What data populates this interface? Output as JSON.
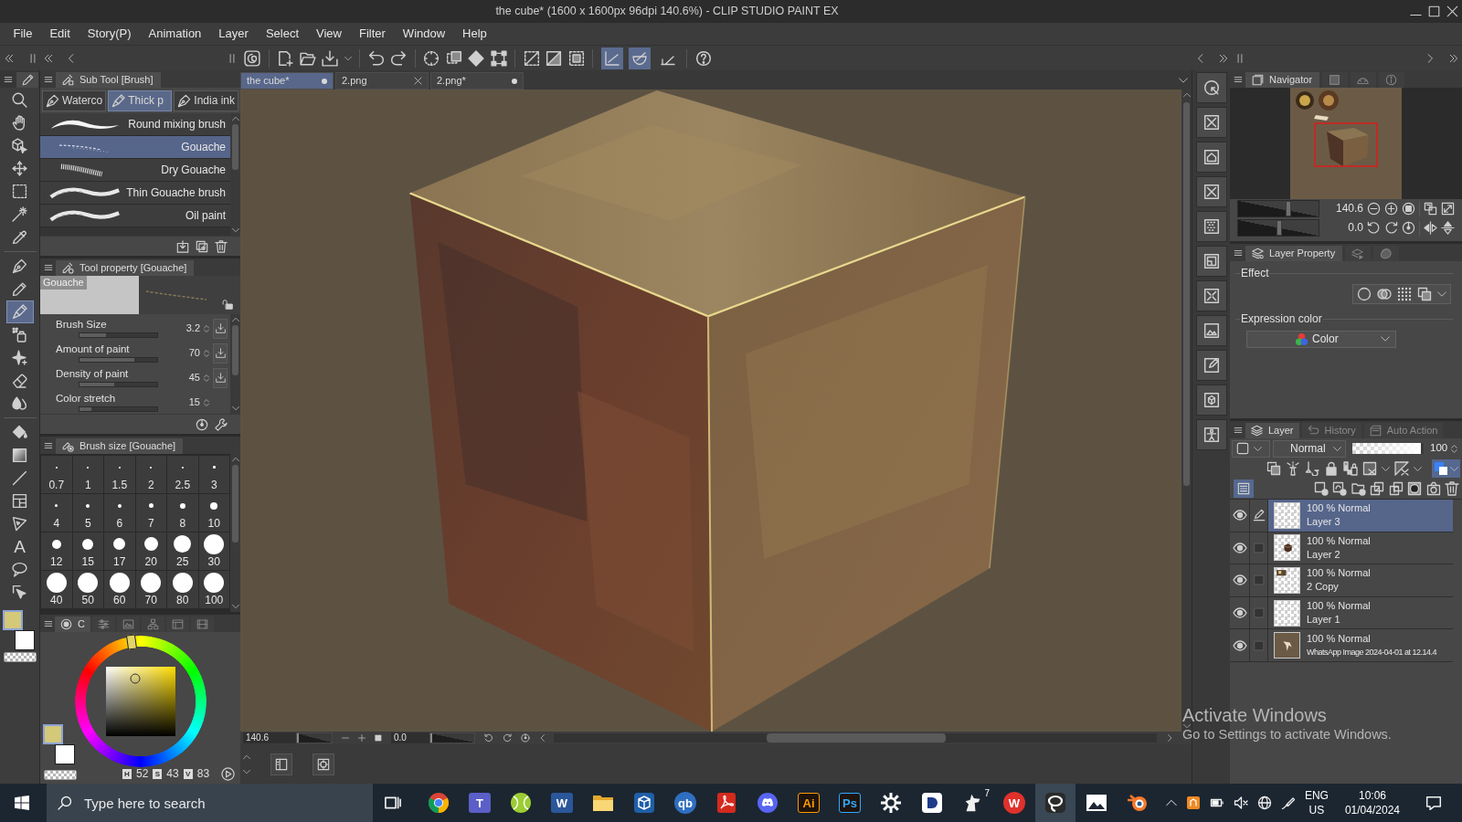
{
  "window": {
    "title": "the cube* (1600 x 1600px 96dpi 140.6%) - CLIP STUDIO PAINT EX"
  },
  "menu": [
    "File",
    "Edit",
    "Story(P)",
    "Animation",
    "Layer",
    "Select",
    "View",
    "Filter",
    "Window",
    "Help"
  ],
  "command_bar": {
    "snap_toggles": [
      {
        "on": true
      },
      {
        "on": true
      },
      {
        "on": false
      }
    ]
  },
  "tools": [
    {
      "kind": "zoom",
      "selected": false
    },
    {
      "kind": "hand",
      "selected": false
    },
    {
      "kind": "object-3d",
      "selected": false
    },
    {
      "kind": "move",
      "selected": false
    },
    {
      "kind": "selection",
      "selected": false
    },
    {
      "kind": "wand",
      "selected": false
    },
    {
      "kind": "dropper",
      "selected": false
    },
    {
      "kind": "nib",
      "selected": false
    },
    {
      "kind": "pencil",
      "selected": false
    },
    {
      "kind": "tube",
      "selected": true
    },
    {
      "kind": "spray",
      "selected": false
    },
    {
      "kind": "sparkle",
      "selected": false
    },
    {
      "kind": "eraser",
      "selected": false
    },
    {
      "kind": "drops",
      "selected": false
    },
    {
      "kind": "bucket",
      "selected": false
    },
    {
      "kind": "gradient",
      "selected": false
    },
    {
      "kind": "line",
      "selected": false
    },
    {
      "kind": "frame",
      "selected": false
    },
    {
      "kind": "ruler",
      "selected": false
    },
    {
      "kind": "text",
      "label": "A",
      "selected": false
    },
    {
      "kind": "balloon",
      "selected": false
    },
    {
      "kind": "correct",
      "selected": false
    }
  ],
  "tool_colors": [
    {
      "kind": "main",
      "color": "#d4c879",
      "selected": true
    },
    {
      "kind": "sub",
      "color": "#ffffff",
      "selected": false
    }
  ],
  "sub_tool": {
    "title": "Sub Tool [Brush]",
    "groups": [
      {
        "label": "Waterco",
        "selected": false
      },
      {
        "label": "Thick p",
        "selected": true
      },
      {
        "label": "India ink",
        "selected": false
      }
    ],
    "brushes": [
      {
        "name": "Round mixing brush",
        "kind": "smooth",
        "selected": false
      },
      {
        "name": "Gouache",
        "kind": "speckle",
        "selected": true
      },
      {
        "name": "Dry Gouache",
        "kind": "dry",
        "selected": false
      },
      {
        "name": "Thin Gouache brush",
        "kind": "streak",
        "selected": false
      },
      {
        "name": "Oil paint",
        "kind": "streak",
        "selected": false
      }
    ]
  },
  "tool_property": {
    "title": "Tool property [Gouache]",
    "preview_label": "Gouache",
    "properties": [
      {
        "label": "Brush Size",
        "value": "3.2",
        "kind": "pinned",
        "level": 0.34
      },
      {
        "label": "Amount of paint",
        "value": "70",
        "kind": "pinned",
        "level": 0.7
      },
      {
        "label": "Density of paint",
        "value": "45",
        "kind": "pinned",
        "level": 0.45
      },
      {
        "label": "Color stretch",
        "value": "15",
        "kind": "plain",
        "level": 0.15
      }
    ]
  },
  "brush_size": {
    "title": "Brush size [Gouache]",
    "sizes": [
      "0.7",
      "1",
      "1.5",
      "2",
      "2.5",
      "3",
      "4",
      "5",
      "6",
      "7",
      "8",
      "10",
      "12",
      "15",
      "17",
      "20",
      "25",
      "30",
      "40",
      "50",
      "60",
      "70",
      "80",
      "100"
    ]
  },
  "color": {
    "tabs": [
      {
        "label": "C",
        "selected": true
      },
      {
        "selected": false
      },
      {
        "selected": false
      },
      {
        "selected": false
      },
      {
        "selected": false
      },
      {
        "selected": false
      }
    ],
    "swatches": [
      {
        "kind": "main",
        "color": "#d4c879",
        "selected": true
      },
      {
        "kind": "sub",
        "color": "#ffffff",
        "selected": false
      }
    ],
    "readouts": [
      {
        "label": "H",
        "value": "52"
      },
      {
        "label": "S",
        "value": "43"
      },
      {
        "label": "V",
        "value": "83"
      }
    ]
  },
  "canvas": {
    "tabs": [
      {
        "label": "the cube*",
        "selected": true,
        "modified": true
      },
      {
        "label": "2.png",
        "selected": false,
        "modified": false
      },
      {
        "label": "2.png*",
        "selected": false,
        "modified": true
      }
    ],
    "zoom": {
      "value": "140.6",
      "level": 0
    },
    "rotation": {
      "value": "0.0",
      "level": 0
    }
  },
  "navigator": {
    "tabs": [
      {
        "label": "Navigator",
        "selected": true
      },
      {
        "selected": false
      },
      {
        "selected": false
      },
      {
        "selected": false
      }
    ],
    "zoom": {
      "value": "140.6",
      "level": 0.63
    },
    "rotation": {
      "value": "0.0",
      "level": 0.51
    }
  },
  "layer_property": {
    "tabs": [
      {
        "label": "Layer Property",
        "selected": true
      },
      {
        "selected": false
      },
      {
        "selected": false
      }
    ],
    "effect_label": "Effect",
    "expression_label": "Expression color",
    "expression_value": "Color"
  },
  "layer_panel": {
    "tabs": [
      {
        "label": "Layer",
        "selected": true
      },
      {
        "label": "History",
        "selected": false
      },
      {
        "label": "Auto Action",
        "selected": false
      }
    ],
    "blend_mode": "Normal",
    "opacity": {
      "value": "100",
      "level": 1
    },
    "layers": [
      {
        "blend": "100 % Normal",
        "name": "Layer 3",
        "kind": "blank",
        "visible": true,
        "editing": true,
        "selected": true
      },
      {
        "blend": "100 % Normal",
        "name": "Layer 2",
        "kind": "cube",
        "visible": true,
        "editing": false,
        "selected": false
      },
      {
        "blend": "100 % Normal",
        "name": "2 Copy",
        "kind": "corner",
        "visible": true,
        "editing": false,
        "selected": false
      },
      {
        "blend": "100 % Normal",
        "name": "Layer 1",
        "kind": "blank",
        "visible": true,
        "editing": false,
        "selected": false
      },
      {
        "blend": "100 % Normal",
        "name": "WhatsApp Image 2024-04-01 at 12.14.4",
        "kind": "photo",
        "visible": true,
        "editing": false,
        "selected": false
      }
    ]
  },
  "activation_notice": {
    "title": "Activate Windows",
    "message": "Go to Settings to activate Windows."
  },
  "taskbar": {
    "search_placeholder": "Type here to search",
    "apps": [
      {
        "kind": "wheel",
        "active": false
      },
      {
        "kind": "tile",
        "label": "T",
        "color": "#5b5fc7",
        "active": false
      },
      {
        "kind": "ball",
        "active": false
      },
      {
        "kind": "tile",
        "label": "W",
        "color": "#2b579a",
        "active": false
      },
      {
        "kind": "folder",
        "active": false
      },
      {
        "kind": "box-tile",
        "active": false
      },
      {
        "kind": "round-tile",
        "label": "qb",
        "color": "#2f6fc0",
        "active": false
      },
      {
        "kind": "document",
        "active": false
      },
      {
        "kind": "gamepad",
        "active": false
      },
      {
        "kind": "dark-tile",
        "label": "Ai",
        "color": "#ff9a00",
        "active": false
      },
      {
        "kind": "dark-tile",
        "label": "Ps",
        "color": "#31a8ff",
        "active": false
      },
      {
        "kind": "gear",
        "active": false
      },
      {
        "kind": "pen-tile",
        "active": false
      },
      {
        "kind": "horse",
        "label": "7",
        "active": false
      },
      {
        "kind": "round-tile",
        "label": "W",
        "color": "#e0312b",
        "active": false
      },
      {
        "kind": "lasso",
        "active": true
      },
      {
        "kind": "picture",
        "active": false
      },
      {
        "kind": "orbit",
        "active": false
      }
    ],
    "language": "ENG",
    "region": "US",
    "time": "10:06",
    "date": "01/04/2024"
  }
}
